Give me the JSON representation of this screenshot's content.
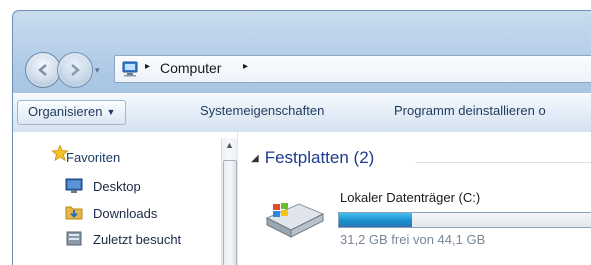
{
  "address": {
    "path_label": "Computer",
    "separator": "▸"
  },
  "nav_buttons": {
    "dropdown": "▾"
  },
  "toolbar": {
    "organize_label": "Organisieren",
    "organize_caret": "▼",
    "system_properties_label": "Systemeigenschaften",
    "uninstall_label": "Programm deinstallieren o"
  },
  "navpane": {
    "favorites_label": "Favoriten",
    "items": [
      {
        "label": "Desktop",
        "icon": "desktop-icon"
      },
      {
        "label": "Downloads",
        "icon": "downloads-folder-icon"
      },
      {
        "label": "Zuletzt besucht",
        "icon": "recent-places-icon"
      }
    ],
    "scroll_up": "▲"
  },
  "main": {
    "group_arrow": "◢",
    "group_title": "Festplatten (2)",
    "drive": {
      "name": "Lokaler Datenträger (C:)",
      "free_text": "31,2 GB frei von 44,1 GB",
      "used_fraction": 0.29,
      "icon": "hard-drive-icon"
    }
  },
  "colors": {
    "accent": "#1e3c8c",
    "bar_fill": "#1a8fcd",
    "toolbar": "#e4edf7",
    "frame": "#a9c6e4"
  }
}
